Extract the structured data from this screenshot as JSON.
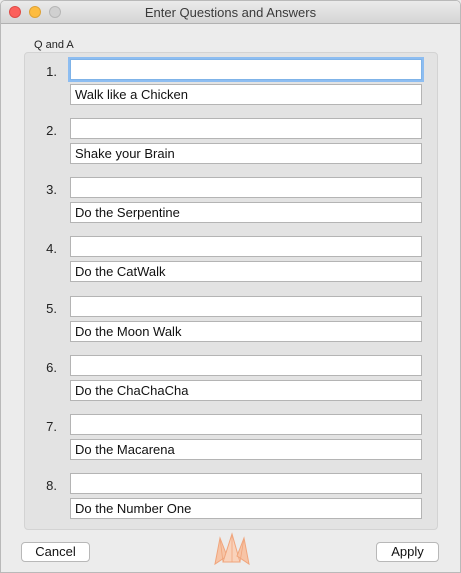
{
  "window": {
    "title": "Enter Questions and Answers"
  },
  "group": {
    "label": "Q and A"
  },
  "rows": [
    {
      "number": "1.",
      "question": "",
      "answer": "Walk like a Chicken"
    },
    {
      "number": "2.",
      "question": "",
      "answer": "Shake your Brain"
    },
    {
      "number": "3.",
      "question": "",
      "answer": "Do the Serpentine"
    },
    {
      "number": "4.",
      "question": "",
      "answer": "Do the CatWalk"
    },
    {
      "number": "5.",
      "question": "",
      "answer": "Do the Moon Walk"
    },
    {
      "number": "6.",
      "question": "",
      "answer": "Do the ChaChaCha"
    },
    {
      "number": "7.",
      "question": "",
      "answer": "Do the Macarena"
    },
    {
      "number": "8.",
      "question": "",
      "answer": "Do the Number One"
    }
  ],
  "buttons": {
    "cancel": "Cancel",
    "apply": "Apply"
  },
  "icons": {
    "logo": "origami-crown-logo-icon"
  },
  "colors": {
    "close": "#fc605c",
    "minimize": "#fdbc40",
    "focus_ring": "#8dbdf1",
    "logo": "#f5b08a"
  }
}
